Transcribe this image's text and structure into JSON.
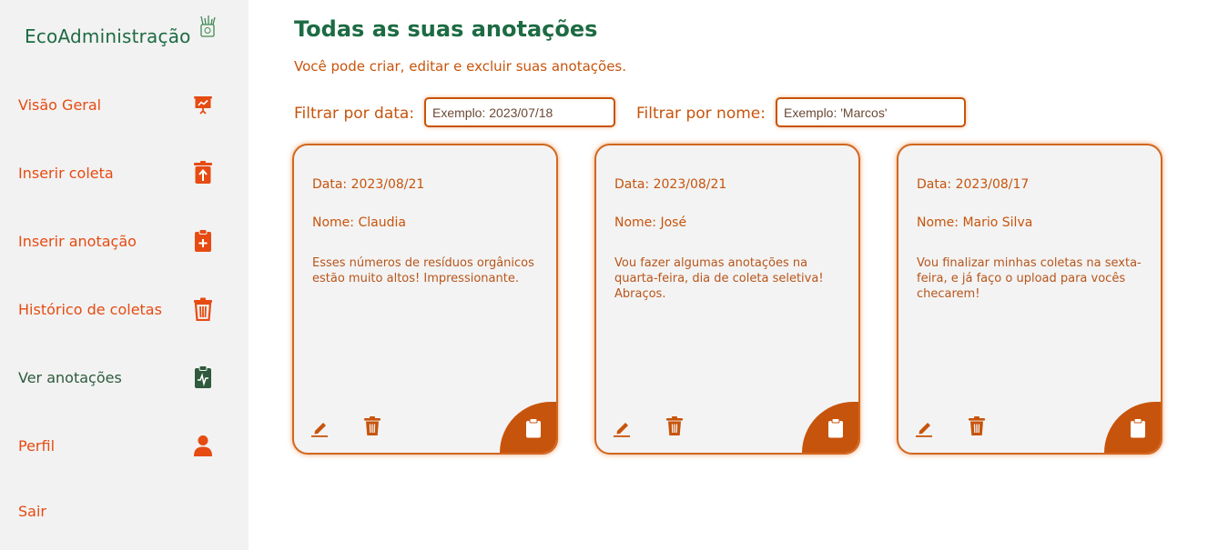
{
  "sidebar": {
    "brand": "EcoAdministração",
    "items": [
      {
        "label": "Visão Geral",
        "icon": "presentation-icon"
      },
      {
        "label": "Inserir coleta",
        "icon": "upload-bin-icon"
      },
      {
        "label": "Inserir anotação",
        "icon": "clipboard-plus-icon"
      },
      {
        "label": "Histórico de coletas",
        "icon": "trash-icon"
      },
      {
        "label": "Ver anotações",
        "icon": "clipboard-pulse-icon"
      },
      {
        "label": "Perfil",
        "icon": "user-icon"
      },
      {
        "label": "Sair",
        "icon": ""
      }
    ]
  },
  "main": {
    "title": "Todas as suas anotações",
    "subtitle": "Você pode criar, editar e excluir suas anotações.",
    "filters": {
      "date_label": "Filtrar por data:",
      "date_placeholder": "Exemplo: 2023/07/18",
      "name_label": "Filtrar por nome:",
      "name_placeholder": "Exemplo: 'Marcos'"
    },
    "notes": [
      {
        "date": "Data: 2023/08/21",
        "name": "Nome: Claudia",
        "text": "Esses números de resíduos orgânicos estão muito altos! Impressionante."
      },
      {
        "date": "Data: 2023/08/21",
        "name": "Nome: José",
        "text": "Vou fazer algumas anotações na quarta-feira, dia de coleta seletiva! Abraços."
      },
      {
        "date": "Data: 2023/08/17",
        "name": "Nome: Mario Silva",
        "text": "Vou finalizar minhas coletas na sexta-feira, e já faço o upload para vocês checarem!"
      }
    ]
  },
  "colors": {
    "brand_green": "#1d6b43",
    "accent_orange": "#c7540c",
    "nav_orange": "#e64b12",
    "active_green": "#2f5a3d",
    "sidebar_bg": "#f2f2f2"
  }
}
